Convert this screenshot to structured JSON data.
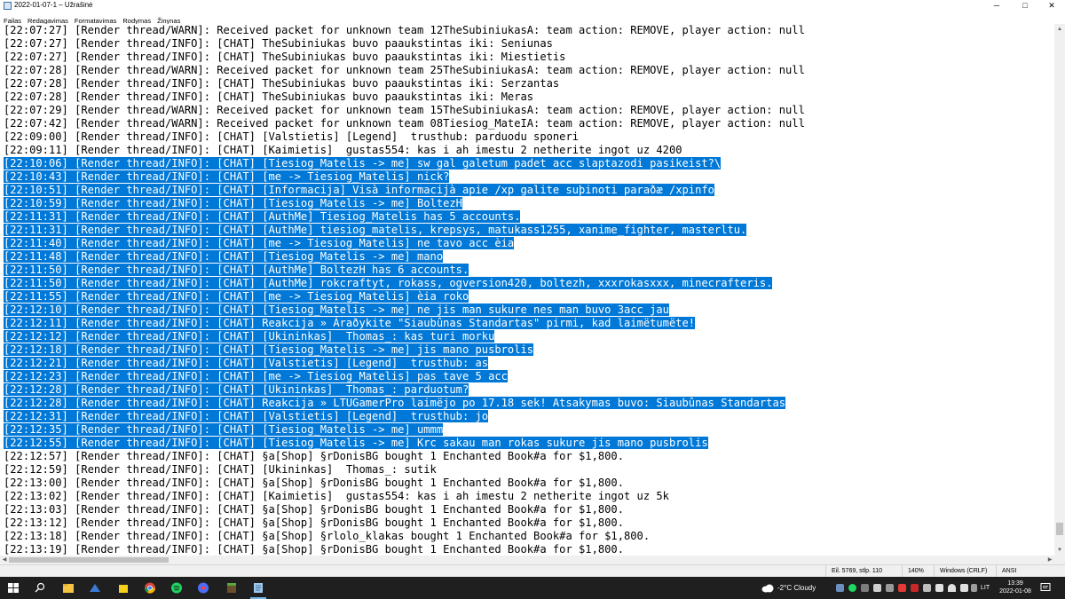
{
  "window": {
    "title": "2022-01-07-1 – Užrašinė",
    "minimize_glyph": "─",
    "maximize_glyph": "□",
    "close_glyph": "✕"
  },
  "menu": [
    "Failas",
    "Redagavimas",
    "Formatavimas",
    "Rodymas",
    "Žinynas"
  ],
  "editor": {
    "selection_color": "#0078d7",
    "lines": [
      {
        "text": "[22:07:27] [Render thread/WARN]: Received packet for unknown team 12TheSubiniukasA: team action: REMOVE, player action: null",
        "selected": false
      },
      {
        "text": "[22:07:27] [Render thread/INFO]: [CHAT] TheSubiniukas buvo paaukstintas iki: Seniunas",
        "selected": false
      },
      {
        "text": "[22:07:27] [Render thread/INFO]: [CHAT] TheSubiniukas buvo paaukstintas iki: Miestietis",
        "selected": false
      },
      {
        "text": "[22:07:28] [Render thread/WARN]: Received packet for unknown team 25TheSubiniukasA: team action: REMOVE, player action: null",
        "selected": false
      },
      {
        "text": "[22:07:28] [Render thread/INFO]: [CHAT] TheSubiniukas buvo paaukstintas iki: Serzantas",
        "selected": false
      },
      {
        "text": "[22:07:28] [Render thread/INFO]: [CHAT] TheSubiniukas buvo paaukstintas iki: Meras",
        "selected": false
      },
      {
        "text": "[22:07:29] [Render thread/WARN]: Received packet for unknown team 15TheSubiniukasA: team action: REMOVE, player action: null",
        "selected": false
      },
      {
        "text": "[22:07:42] [Render thread/WARN]: Received packet for unknown team 08Tiesiog_MateIA: team action: REMOVE, player action: null",
        "selected": false
      },
      {
        "text": "[22:09:00] [Render thread/INFO]: [CHAT] [Valstietis] [Legend]  trusthub: parduodu sponeri",
        "selected": false
      },
      {
        "text": "[22:09:11] [Render thread/INFO]: [CHAT] [Kaimietis]  gustas554: kas i ah imestu 2 netherite ingot uz 4200",
        "selected": false
      },
      {
        "text": "[22:10:06] [Render thread/INFO]: [CHAT] [Tiesiog_Matelis -> me] sw gal galetum padet acc slaptazodi pasikeist?\\",
        "selected": true
      },
      {
        "text": "[22:10:43] [Render thread/INFO]: [CHAT] [me -> Tiesiog_Matelis] nick?",
        "selected": true
      },
      {
        "text": "[22:10:51] [Render thread/INFO]: [CHAT] [Informacija] Visà informacijà apie /xp galite suþinoti paraðæ /xpinfo",
        "selected": true
      },
      {
        "text": "[22:10:59] [Render thread/INFO]: [CHAT] [Tiesiog_Matelis -> me] BoltezH",
        "selected": true
      },
      {
        "text": "[22:11:31] [Render thread/INFO]: [CHAT] [AuthMe] Tiesiog_Matelis has 5 accounts.",
        "selected": true
      },
      {
        "text": "[22:11:31] [Render thread/INFO]: [CHAT] [AuthMe] tiesiog_matelis, krepsys, matukass1255, xanime_fighter, masterltu.",
        "selected": true
      },
      {
        "text": "[22:11:40] [Render thread/INFO]: [CHAT] [me -> Tiesiog_Matelis] ne tavo acc èia",
        "selected": true
      },
      {
        "text": "[22:11:48] [Render thread/INFO]: [CHAT] [Tiesiog_Matelis -> me] mano",
        "selected": true
      },
      {
        "text": "[22:11:50] [Render thread/INFO]: [CHAT] [AuthMe] BoltezH has 6 accounts.",
        "selected": true
      },
      {
        "text": "[22:11:50] [Render thread/INFO]: [CHAT] [AuthMe] rokcraftyt, rokass, ogversion420, boltezh, xxxrokasxxx, minecrafteris.",
        "selected": true
      },
      {
        "text": "[22:11:55] [Render thread/INFO]: [CHAT] [me -> Tiesiog_Matelis] èia roko",
        "selected": true
      },
      {
        "text": "[22:12:10] [Render thread/INFO]: [CHAT] [Tiesiog_Matelis -> me] ne jis man sukure nes man buvo 3acc jau",
        "selected": true
      },
      {
        "text": "[22:12:11] [Render thread/INFO]: [CHAT] Reakcija » Áraðykite \"Siaubûnas Standartas\" pirmi, kad laimëtumëte!",
        "selected": true
      },
      {
        "text": "[22:12:12] [Render thread/INFO]: [CHAT] [Ukininkas]  Thomas_: kas turi morku",
        "selected": true
      },
      {
        "text": "[22:12:18] [Render thread/INFO]: [CHAT] [Tiesiog_Matelis -> me] jis mano pusbrolis",
        "selected": true
      },
      {
        "text": "[22:12:21] [Render thread/INFO]: [CHAT] [Valstietis] [Legend]  trusthub: as",
        "selected": true
      },
      {
        "text": "[22:12:23] [Render thread/INFO]: [CHAT] [me -> Tiesiog_Matelis] pas tave 5 acc",
        "selected": true
      },
      {
        "text": "[22:12:28] [Render thread/INFO]: [CHAT] [Ukininkas]  Thomas_: parduotum?",
        "selected": true
      },
      {
        "text": "[22:12:28] [Render thread/INFO]: [CHAT] Reakcija » LTUGamerPro laimëjo po 17.18 sek! Atsakymas buvo: Siaubûnas Standartas",
        "selected": true
      },
      {
        "text": "[22:12:31] [Render thread/INFO]: [CHAT] [Valstietis] [Legend]  trusthub: jo",
        "selected": true
      },
      {
        "text": "[22:12:35] [Render thread/INFO]: [CHAT] [Tiesiog_Matelis -> me] ummm",
        "selected": true
      },
      {
        "text": "[22:12:55] [Render thread/INFO]: [CHAT] [Tiesiog_Matelis -> me] Krc sakau man rokas sukure jis mano pusbrolis",
        "selected": true
      },
      {
        "text": "[22:12:57] [Render thread/INFO]: [CHAT] §a[Shop] §rDonisBG bought 1 Enchanted Book#a for $1,800.",
        "selected": false
      },
      {
        "text": "[22:12:59] [Render thread/INFO]: [CHAT] [Ukininkas]  Thomas_: sutik",
        "selected": false
      },
      {
        "text": "[22:13:00] [Render thread/INFO]: [CHAT] §a[Shop] §rDonisBG bought 1 Enchanted Book#a for $1,800.",
        "selected": false
      },
      {
        "text": "[22:13:02] [Render thread/INFO]: [CHAT] [Kaimietis]  gustas554: kas i ah imestu 2 netherite ingot uz 5k",
        "selected": false
      },
      {
        "text": "[22:13:03] [Render thread/INFO]: [CHAT] §a[Shop] §rDonisBG bought 1 Enchanted Book#a for $1,800.",
        "selected": false
      },
      {
        "text": "[22:13:12] [Render thread/INFO]: [CHAT] §a[Shop] §rDonisBG bought 1 Enchanted Book#a for $1,800.",
        "selected": false
      },
      {
        "text": "[22:13:18] [Render thread/INFO]: [CHAT] §a[Shop] §rlolo_klakas bought 1 Enchanted Book#a for $1,800.",
        "selected": false
      },
      {
        "text": "[22:13:19] [Render thread/INFO]: [CHAT] §a[Shop] §rDonisBG bought 1 Enchanted Book#a for $1,800.",
        "selected": false
      }
    ]
  },
  "statusbar": {
    "position": "Eil. 5769, stlp. 110",
    "zoom": "140%",
    "line_endings": "Windows (CRLF)",
    "encoding": "ANSI"
  },
  "taskbar": {
    "apps": [
      {
        "name": "start-button",
        "color": "#ffffff"
      },
      {
        "name": "search-button",
        "color": "#ffffff"
      },
      {
        "name": "file-explorer",
        "color": "#f4c542"
      },
      {
        "name": "app-blue",
        "color": "#3a7bd5"
      },
      {
        "name": "sticky-notes",
        "color": "#f7d21b"
      },
      {
        "name": "chrome",
        "color": "#db4437"
      },
      {
        "name": "spotify",
        "color": "#1ed760"
      },
      {
        "name": "app-disc",
        "color": "#4a6cf7"
      },
      {
        "name": "minecraft",
        "color": "#6b4f2a"
      },
      {
        "name": "notepad",
        "color": "#9ec9ef",
        "active": true
      }
    ],
    "weather_temp": "-2°C",
    "weather_text": "Cloudy",
    "language": "LIT",
    "time": "13:39",
    "date": "2022-01-08"
  }
}
